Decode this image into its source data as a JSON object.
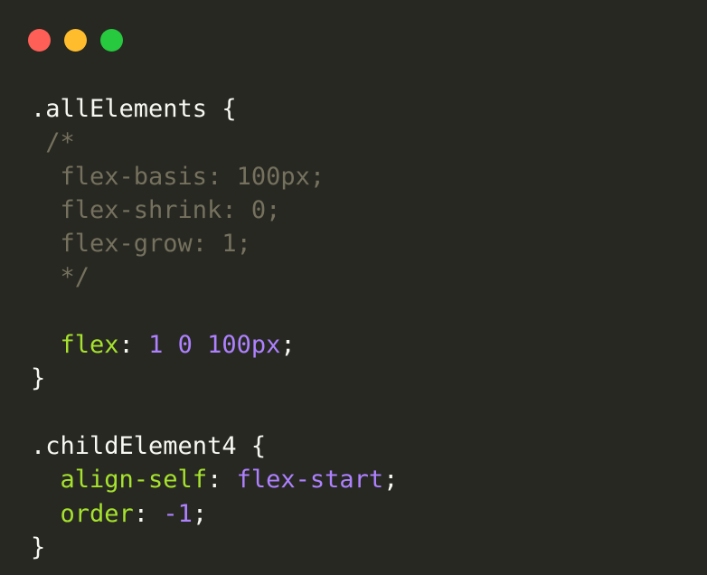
{
  "window": {
    "traffic_lights": [
      {
        "name": "close",
        "color": "#ff5f56"
      },
      {
        "name": "minimize",
        "color": "#ffbd2e"
      },
      {
        "name": "maximize",
        "color": "#27c93f"
      }
    ],
    "background": "#272822"
  },
  "colors": {
    "text": "#f8f8f2",
    "comment": "#75715e",
    "property": "#a6e22e",
    "value": "#ae81ff"
  },
  "code": {
    "lines": [
      [
        {
          "t": ".allElements {",
          "k": "plain"
        }
      ],
      [
        {
          "t": " /*",
          "k": "comment"
        }
      ],
      [
        {
          "t": "  flex-basis: 100px;",
          "k": "comment"
        }
      ],
      [
        {
          "t": "  flex-shrink: 0;",
          "k": "comment"
        }
      ],
      [
        {
          "t": "  flex-grow: 1;",
          "k": "comment"
        }
      ],
      [
        {
          "t": "  */",
          "k": "comment"
        }
      ],
      [],
      [
        {
          "t": "  ",
          "k": "plain"
        },
        {
          "t": "flex",
          "k": "prop"
        },
        {
          "t": ": ",
          "k": "plain"
        },
        {
          "t": "1 0 100px",
          "k": "num"
        },
        {
          "t": ";",
          "k": "plain"
        }
      ],
      [
        {
          "t": "}",
          "k": "plain"
        }
      ],
      [],
      [
        {
          "t": ".childElement4 {",
          "k": "plain"
        }
      ],
      [
        {
          "t": "  ",
          "k": "plain"
        },
        {
          "t": "align-self",
          "k": "prop"
        },
        {
          "t": ": ",
          "k": "plain"
        },
        {
          "t": "flex-start",
          "k": "value"
        },
        {
          "t": ";",
          "k": "plain"
        }
      ],
      [
        {
          "t": "  ",
          "k": "plain"
        },
        {
          "t": "order",
          "k": "prop"
        },
        {
          "t": ": ",
          "k": "plain"
        },
        {
          "t": "-1",
          "k": "num"
        },
        {
          "t": ";",
          "k": "plain"
        }
      ],
      [
        {
          "t": "}",
          "k": "plain"
        }
      ]
    ]
  }
}
